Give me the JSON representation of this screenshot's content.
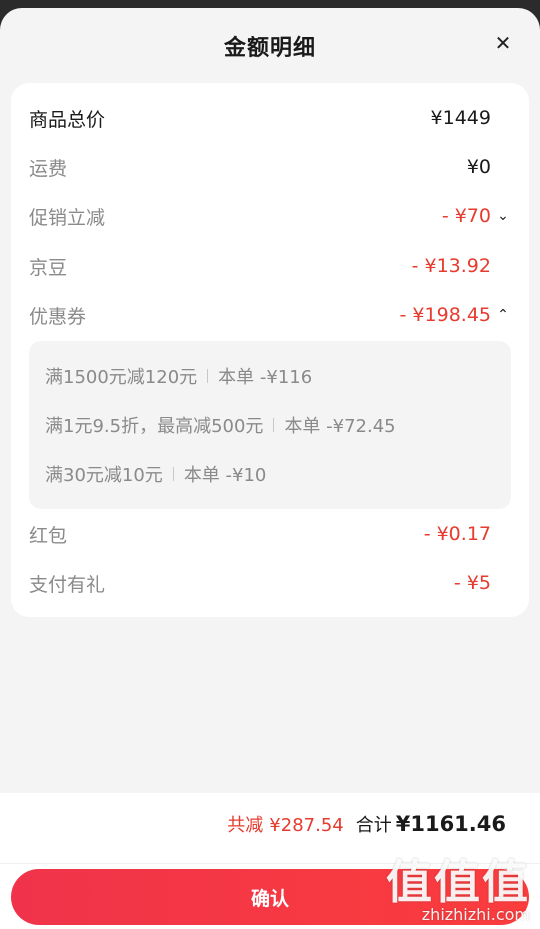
{
  "header": {
    "title": "金额明细",
    "close_icon": "close-icon"
  },
  "rows": [
    {
      "label": "商品总价",
      "value": "¥1449"
    },
    {
      "label": "运费",
      "value": "¥0"
    },
    {
      "label": "促销立减",
      "value": "- ¥70",
      "toggle": "chevron-down-icon"
    },
    {
      "label": "京豆",
      "value": "- ¥13.92"
    },
    {
      "label": "优惠券",
      "value": "- ¥198.45",
      "toggle": "chevron-up-icon"
    },
    {
      "label": "红包",
      "value": "- ¥0.17"
    },
    {
      "label": "支付有礼",
      "value": "- ¥5"
    }
  ],
  "coupons": [
    {
      "rule": "满1500元减120元",
      "discount": "本单 -¥116"
    },
    {
      "rule": "满1元9.5折，最高减500元",
      "discount": "本单 -¥72.45"
    },
    {
      "rule": "满30元减10元",
      "discount": "本单 -¥10"
    }
  ],
  "footer": {
    "saved_label": "共减",
    "saved_value": "¥287.54",
    "total_label": "合计",
    "total_value": "¥1161.46",
    "confirm_label": "确认"
  },
  "watermark": {
    "main": "值值值",
    "sub": "zhizhizhi.com"
  },
  "colors": {
    "accent": "#e63b2e",
    "button": "#f0334a",
    "card": "#ffffff",
    "sheet": "#f4f4f4"
  }
}
